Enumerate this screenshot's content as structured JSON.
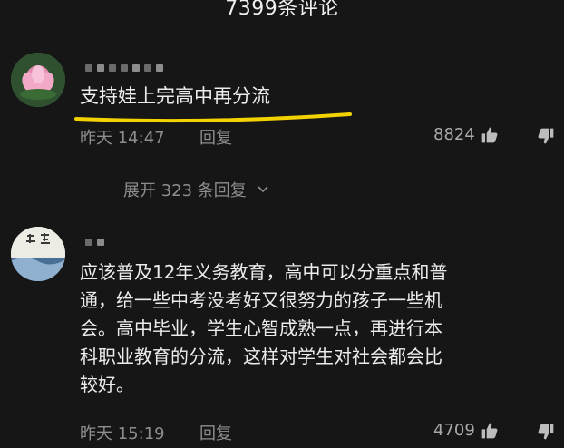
{
  "header": {
    "title": "7399条评论"
  },
  "comments": [
    {
      "text": "支持娃上完高中再分流",
      "time": "昨天 14:47",
      "reply_label": "回复",
      "likes": "8824",
      "expand_label": "展开 323 条回复"
    },
    {
      "lines": [
        "应该普及12年义务教育，高中可以分重点和普",
        "通，给一些中考没考好又很努力的孩子一些机",
        "会。高中毕业，学生心智成熟一点，再进行本",
        "科职业教育的分流，这样对学生对社会都会比",
        "较好。"
      ],
      "time": "昨天 15:19",
      "reply_label": "回复",
      "likes": "4709"
    }
  ],
  "colors": {
    "background": "#161616",
    "highlight_underline": "#f2d200"
  },
  "icons": {
    "like": "thumbs-up-icon",
    "dislike": "thumbs-down-icon",
    "expand": "chevron-down-icon"
  }
}
